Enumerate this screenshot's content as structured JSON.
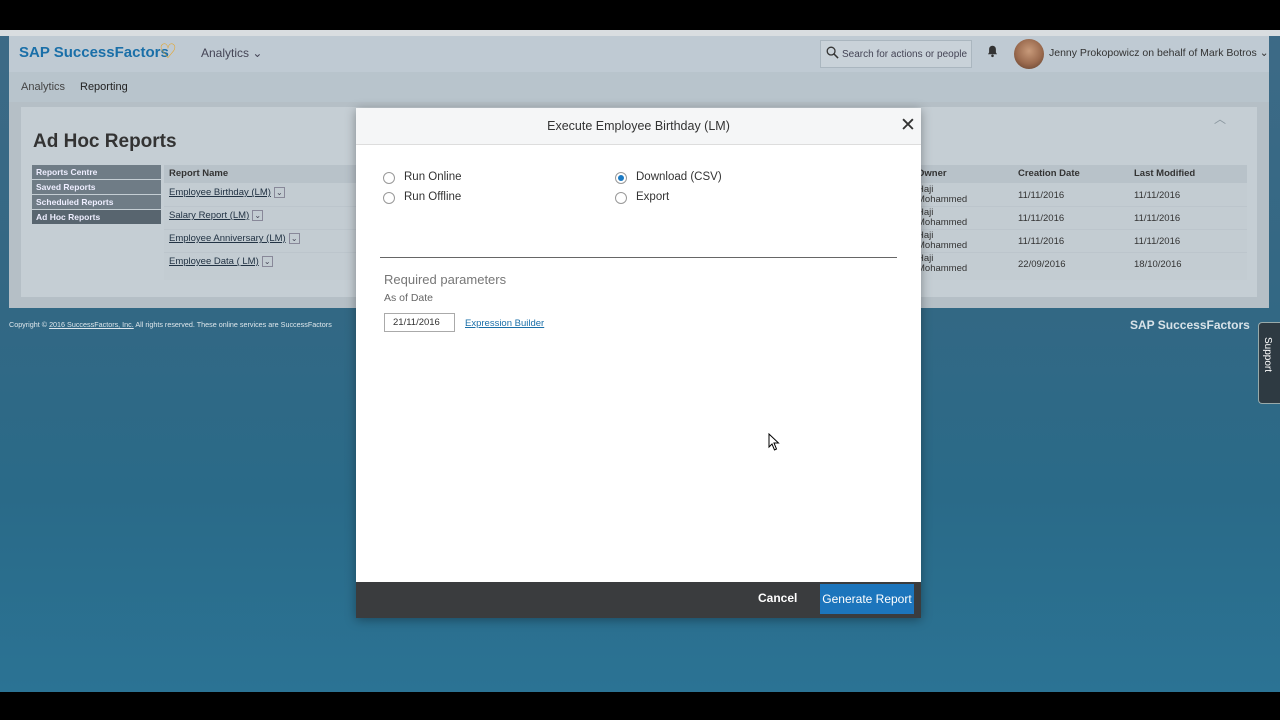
{
  "header": {
    "logo_text": "SAP SuccessFactors",
    "module_label": "Analytics",
    "search_placeholder": "Search for actions or people",
    "user_label": "Jenny Prokopowicz on behalf of Mark Botros"
  },
  "subnav": {
    "items": [
      "Analytics",
      "Reporting"
    ]
  },
  "page": {
    "title": "Ad Hoc Reports",
    "side_menu": [
      "Reports Centre",
      "Saved Reports",
      "Scheduled Reports",
      "Ad Hoc Reports"
    ],
    "table": {
      "columns": [
        "Report Name",
        "Owner",
        "Creation Date",
        "Last Modified"
      ],
      "rows": [
        {
          "name": "Employee Birthday (LM)",
          "owner_1": "Haji",
          "owner_2": "Mohammed",
          "created": "11/11/2016",
          "modified": "11/11/2016"
        },
        {
          "name": "Salary Report (LM)",
          "owner_1": "Haji",
          "owner_2": "Mohammed",
          "created": "11/11/2016",
          "modified": "11/11/2016"
        },
        {
          "name": "Employee Anniversary (LM)",
          "owner_1": "Haji",
          "owner_2": "Mohammed",
          "created": "11/11/2016",
          "modified": "11/11/2016"
        },
        {
          "name": "Employee Data ( LM)",
          "owner_1": "Haji",
          "owner_2": "Mohammed",
          "created": "22/09/2016",
          "modified": "18/10/2016"
        }
      ]
    }
  },
  "footer": {
    "prefix": "Copyright ©",
    "link": "2016 SuccessFactors, Inc.",
    "suffix": "All rights reserved. These online services are SuccessFactors",
    "logo": "SAP SuccessFactors"
  },
  "support": {
    "label": "Support"
  },
  "modal": {
    "title": "Execute Employee Birthday (LM)",
    "options_left": [
      "Run Online",
      "Run Offline"
    ],
    "options_right": [
      "Download (CSV)",
      "Export"
    ],
    "selected_option": "Download (CSV)",
    "required_title": "Required parameters",
    "as_of_label": "As of Date",
    "as_of_value": "21/11/2016",
    "expression_link": "Expression Builder",
    "cancel_label": "Cancel",
    "generate_label": "Generate Report"
  },
  "colors": {
    "accent": "#1c75bc",
    "logo_heart": "#e8a21c",
    "modal_footer": "#3a3c3e"
  },
  "icons": [
    "search-icon",
    "bell-icon",
    "close-icon",
    "chevron-down-icon",
    "heart-logo-icon",
    "mouse-cursor-icon"
  ]
}
